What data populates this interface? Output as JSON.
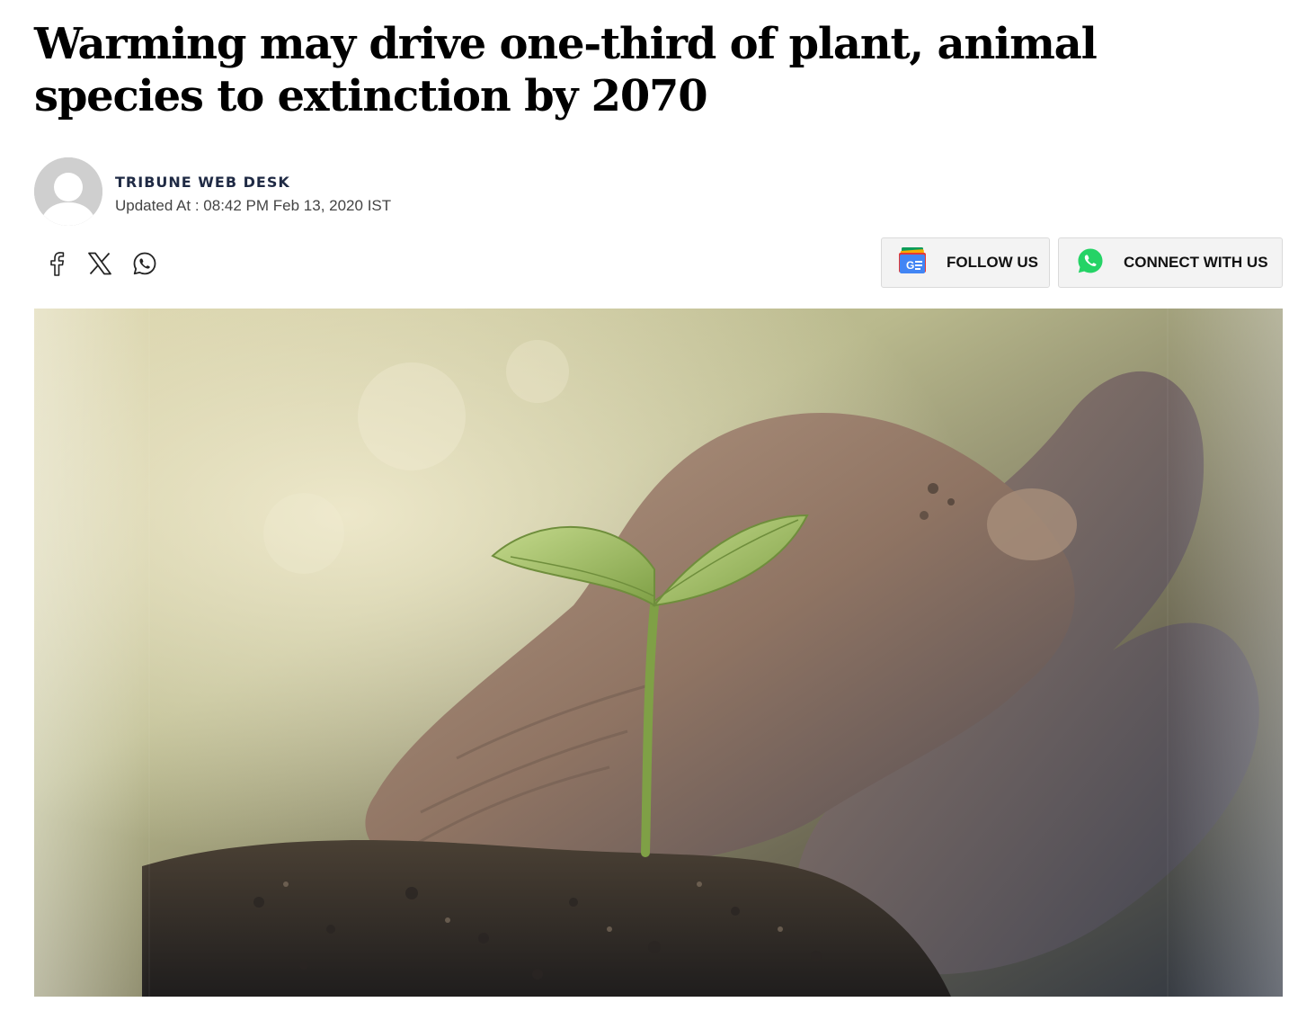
{
  "article": {
    "headline": "Warming may drive one-third of plant, animal species to extinction by 2070",
    "author": "TRIBUNE WEB DESK",
    "updated": "Updated At : 08:42 PM Feb 13, 2020 IST"
  },
  "share": {
    "icons": [
      "facebook-icon",
      "x-icon",
      "whatsapp-icon"
    ]
  },
  "actions": {
    "follow_label": "FOLLOW US",
    "connect_label": "CONNECT WITH US"
  },
  "colors": {
    "author": "#1f2a44",
    "button_bg": "#f3f3f3",
    "whatsapp_green": "#25d366"
  }
}
